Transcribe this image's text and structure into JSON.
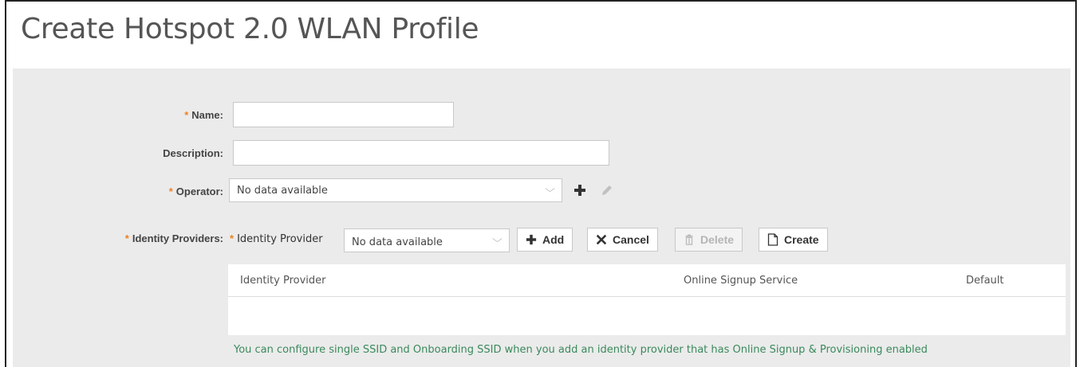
{
  "page": {
    "title": "Create Hotspot 2.0 WLAN Profile"
  },
  "form": {
    "required_mark": "*",
    "name": {
      "label": "Name:",
      "value": ""
    },
    "description": {
      "label": "Description:",
      "value": ""
    },
    "operator": {
      "label": "Operator:",
      "selected": "No data available"
    },
    "identity_providers": {
      "label": "Identity Providers:",
      "provider_label": "Identity Provider",
      "provider_selected": "No data available",
      "buttons": {
        "add": "Add",
        "cancel": "Cancel",
        "delete": "Delete",
        "create": "Create"
      }
    }
  },
  "table": {
    "columns": [
      "Identity Provider",
      "Online Signup Service",
      "Default"
    ],
    "rows": []
  },
  "hint": "You can configure single SSID and Onboarding SSID when you add an identity provider that has Online Signup & Provisioning enabled",
  "icons": {
    "operator_add": "plus-icon",
    "operator_edit": "pencil-icon",
    "add": "plus-icon",
    "cancel": "x-icon",
    "delete": "trash-icon",
    "create": "document-icon",
    "dropdown": "chevron-down-icon"
  },
  "colors": {
    "required": "#f0801f",
    "hint": "#3a8a5c",
    "panel": "#ebebeb"
  }
}
